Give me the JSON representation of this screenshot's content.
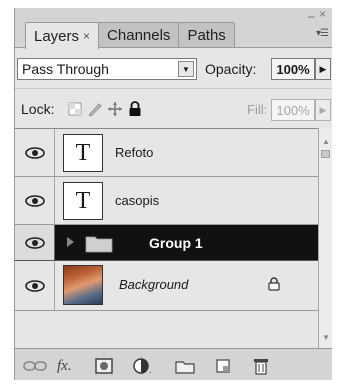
{
  "tabs": [
    {
      "label": "Layers",
      "close": "×",
      "active": true
    },
    {
      "label": "Channels",
      "active": false
    },
    {
      "label": "Paths",
      "active": false
    }
  ],
  "blend": {
    "mode": "Pass Through",
    "opacity_label": "Opacity:",
    "opacity_value": "100%"
  },
  "lock": {
    "label": "Lock:",
    "fill_label": "Fill:",
    "fill_value": "100%"
  },
  "layers": [
    {
      "name": "Refoto",
      "type": "text",
      "thumb": "T",
      "visible": true,
      "selected": false
    },
    {
      "name": "casopis",
      "type": "text",
      "thumb": "T",
      "visible": true,
      "selected": false
    },
    {
      "name": "Group 1",
      "type": "group",
      "visible": true,
      "selected": true
    },
    {
      "name": "Background",
      "type": "image",
      "visible": true,
      "selected": false,
      "locked": true
    }
  ],
  "icons": {
    "eye": "eye-icon",
    "folder": "folder-icon",
    "lock": "lock-icon",
    "bottom": [
      "link-layers-icon",
      "fx-icon",
      "mask-icon",
      "adjustment-icon",
      "new-group-icon",
      "new-layer-icon",
      "trash-icon"
    ]
  },
  "colors": {
    "selected_row": "#111111",
    "panel": "#e6e6e6"
  }
}
